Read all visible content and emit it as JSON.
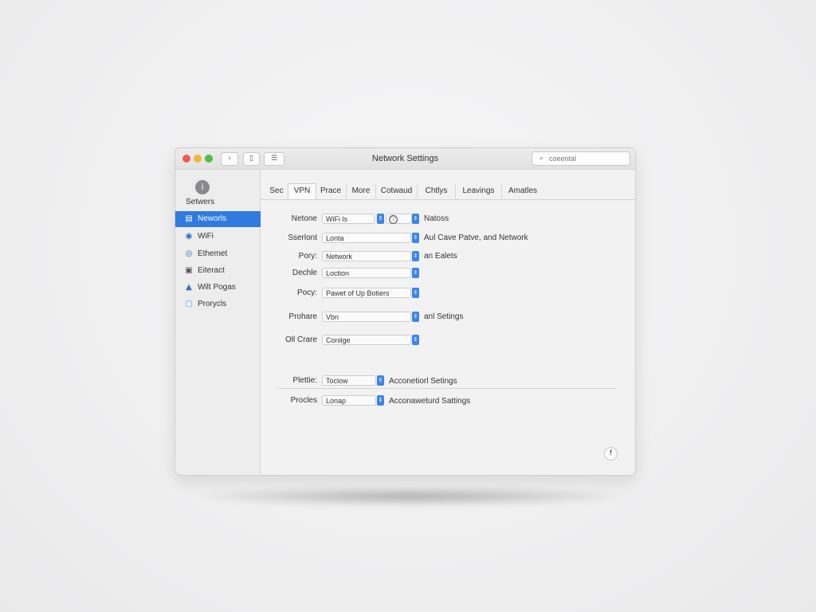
{
  "window": {
    "title": "Network Settings",
    "toolbar": {
      "back_icon_label": "‹",
      "sidebar_toggle_label": "▯",
      "list_toggle_label": "☰"
    }
  },
  "search": {
    "placeholder": "coeental"
  },
  "sidebar": {
    "header_label": "Setwers",
    "header_icon": "i",
    "items": [
      {
        "label": "Neworls",
        "icon": "network-icon",
        "glyph": "▤",
        "active": true
      },
      {
        "label": "WiFi",
        "icon": "wifi-icon",
        "glyph": "◉",
        "active": false
      },
      {
        "label": "Ethemet",
        "icon": "ethernet-icon",
        "glyph": "◎",
        "active": false
      },
      {
        "label": "Eiteract",
        "icon": "interface-icon",
        "glyph": "▣",
        "active": false
      },
      {
        "label": "Wilt Pogas",
        "icon": "vpn-icon",
        "glyph": "▲",
        "active": false
      },
      {
        "label": "Prorycls",
        "icon": "proxies-icon",
        "glyph": "▢",
        "active": false
      }
    ]
  },
  "tabs": [
    {
      "label": "Sec",
      "active": false
    },
    {
      "label": "VPN",
      "active": true
    },
    {
      "label": "Prace",
      "active": false
    },
    {
      "label": "More",
      "active": false
    },
    {
      "label": "Cotwaud",
      "active": false
    },
    {
      "label": "Chtlys",
      "active": false
    },
    {
      "label": "Leavings",
      "active": false
    },
    {
      "label": "Amatles",
      "active": false
    }
  ],
  "rows": [
    {
      "label": "Netone",
      "value": "WiFi ls",
      "note": "Natoss",
      "info_icon": "ⓘ"
    },
    {
      "label": "Sserlont",
      "value": "Lonta",
      "note": "Aul Cave Patve, and Network"
    },
    {
      "label": "Pory:",
      "value": "Network",
      "note": "an Ealets"
    },
    {
      "label": "Dechle",
      "value": "Loction",
      "note": ""
    },
    {
      "label": "Pocy:",
      "value": "Pawet of Up Botiers",
      "note": ""
    },
    {
      "label": "Prohare",
      "value": "Vbn",
      "note": "anl Setings"
    },
    {
      "label": "Oll Crare",
      "value": "Coniige",
      "note": ""
    },
    {
      "label": "Plettie:",
      "value": "Toclow",
      "note": "Acconetiorl Setings"
    },
    {
      "label": "Procles",
      "value": "Lonap",
      "note": "Acconaweturd Sattings"
    }
  ],
  "help_icon": "f",
  "stepper_glyph": "⇕",
  "colors": {
    "accent": "#2f7be0",
    "stepper": "#3b86e6",
    "close": "#ee5b52",
    "minimize": "#f4b53a",
    "zoom": "#4cbf44"
  }
}
